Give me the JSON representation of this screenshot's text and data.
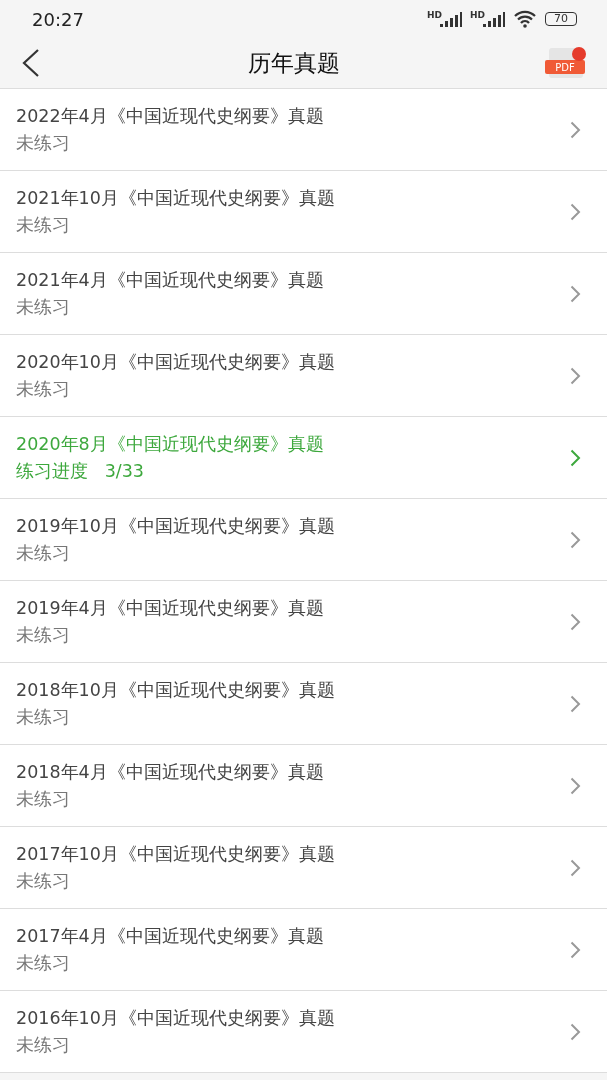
{
  "status_bar": {
    "time": "20:27",
    "signal_labels": [
      "HD",
      "HD"
    ],
    "battery": "70"
  },
  "header": {
    "title": "历年真题",
    "pdf_label": "PDF"
  },
  "papers": [
    {
      "title": "2022年4月《中国近现代史纲要》真题",
      "status": "未练习",
      "practiced": false
    },
    {
      "title": "2021年10月《中国近现代史纲要》真题",
      "status": "未练习",
      "practiced": false
    },
    {
      "title": "2021年4月《中国近现代史纲要》真题",
      "status": "未练习",
      "practiced": false
    },
    {
      "title": "2020年10月《中国近现代史纲要》真题",
      "status": "未练习",
      "practiced": false
    },
    {
      "title": "2020年8月《中国近现代史纲要》真题",
      "status": "练习进度   3/33",
      "practiced": true
    },
    {
      "title": "2019年10月《中国近现代史纲要》真题",
      "status": "未练习",
      "practiced": false
    },
    {
      "title": "2019年4月《中国近现代史纲要》真题",
      "status": "未练习",
      "practiced": false
    },
    {
      "title": "2018年10月《中国近现代史纲要》真题",
      "status": "未练习",
      "practiced": false
    },
    {
      "title": "2018年4月《中国近现代史纲要》真题",
      "status": "未练习",
      "practiced": false
    },
    {
      "title": "2017年10月《中国近现代史纲要》真题",
      "status": "未练习",
      "practiced": false
    },
    {
      "title": "2017年4月《中国近现代史纲要》真题",
      "status": "未练习",
      "practiced": false
    },
    {
      "title": "2016年10月《中国近现代史纲要》真题",
      "status": "未练习",
      "practiced": false
    }
  ]
}
